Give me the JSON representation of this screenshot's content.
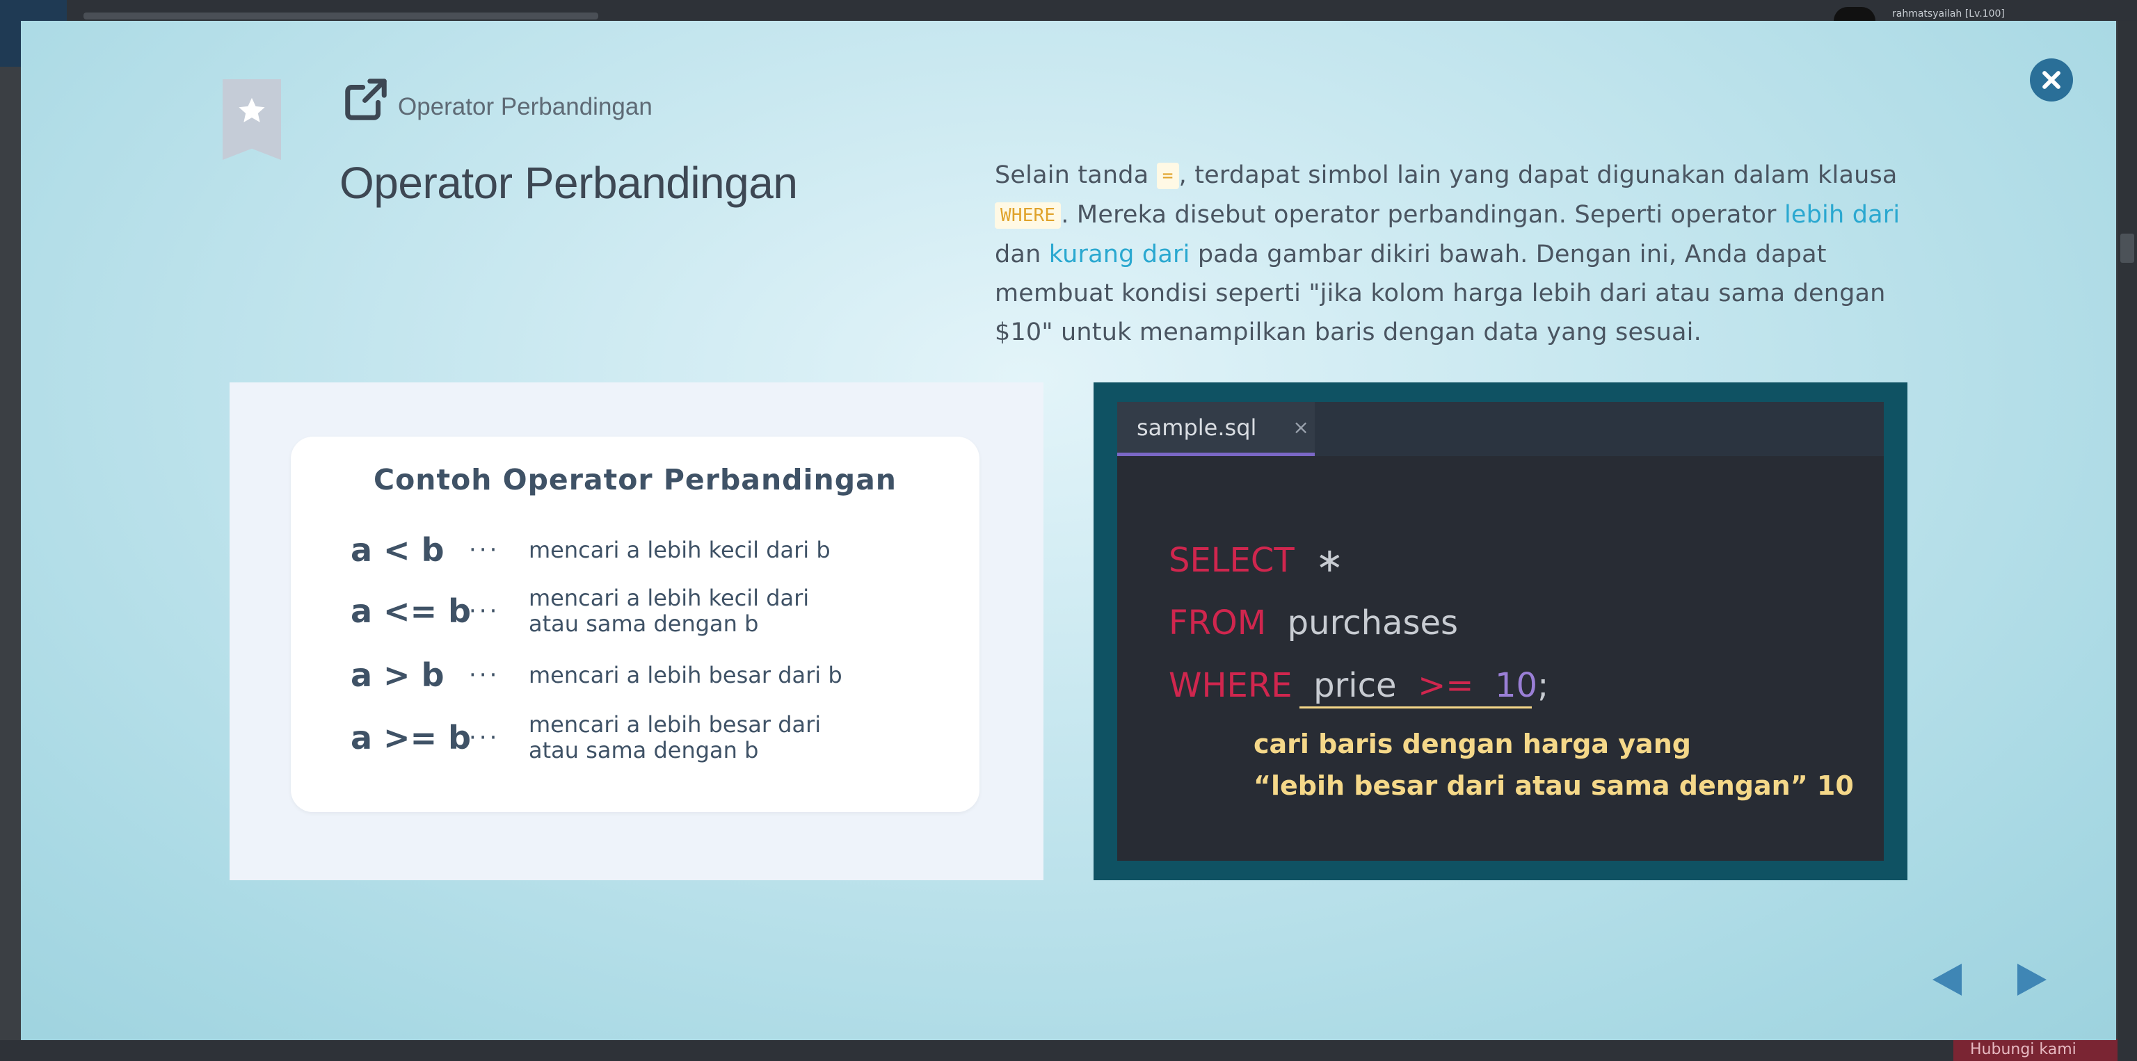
{
  "background": {
    "username": "rahmatsyailah [Lv.100]",
    "bottom_button": "Hubungi kami"
  },
  "colors": {
    "accent_blue": "#2aa8d0",
    "close_button": "#2a6f98",
    "code_keyword": "#d0264e",
    "code_number": "#9a7fd6",
    "annotation": "#f5d889",
    "nav_arrow": "#3f86b5"
  },
  "header": {
    "bookmark_icon": "star-icon",
    "link_icon": "external-link-icon",
    "breadcrumb": "Operator Perbandingan",
    "title": "Operator Perbandingan"
  },
  "description": {
    "p1": "Selain tanda ",
    "code1": "=",
    "p2": ", terdapat simbol lain yang dapat digunakan dalam klausa ",
    "code2": "WHERE",
    "p3": ". Mereka disebut operator perbandingan. Seperti operator ",
    "link1": "lebih dari",
    "p4": " dan ",
    "link2": "kurang dari",
    "p5": " pada gambar dikiri bawah. Dengan ini, Anda dapat membuat kondisi seperti \"jika kolom harga lebih dari atau sama dengan $10\" untuk menampilkan baris dengan data yang sesuai."
  },
  "operator_card": {
    "title": "Contoh Operator Perbandingan",
    "rows": [
      {
        "expr": "a < b",
        "dots": "···",
        "desc": "mencari a lebih kecil dari b"
      },
      {
        "expr": "a <= b",
        "dots": "···",
        "desc": "mencari a lebih kecil dari\natau sama dengan b"
      },
      {
        "expr": "a > b",
        "dots": "···",
        "desc": "mencari a lebih besar dari b"
      },
      {
        "expr": "a >= b",
        "dots": "···",
        "desc": "mencari a lebih besar dari\natau sama dengan b"
      }
    ]
  },
  "editor": {
    "tab_name": "sample.sql",
    "tab_close": "×",
    "line1_kw": "SELECT",
    "line1_rest": "∗",
    "line2_kw": "FROM",
    "line2_rest": "purchases",
    "line3_kw": "WHERE",
    "line3_col": "price",
    "line3_op": ">=",
    "line3_num": "10",
    "line3_end": ";",
    "annotation_line1": "cari baris dengan harga yang",
    "annotation_line2": "“lebih besar dari atau sama dengan” 10"
  },
  "navigation": {
    "prev_icon": "triangle-left-icon",
    "next_icon": "triangle-right-icon"
  }
}
